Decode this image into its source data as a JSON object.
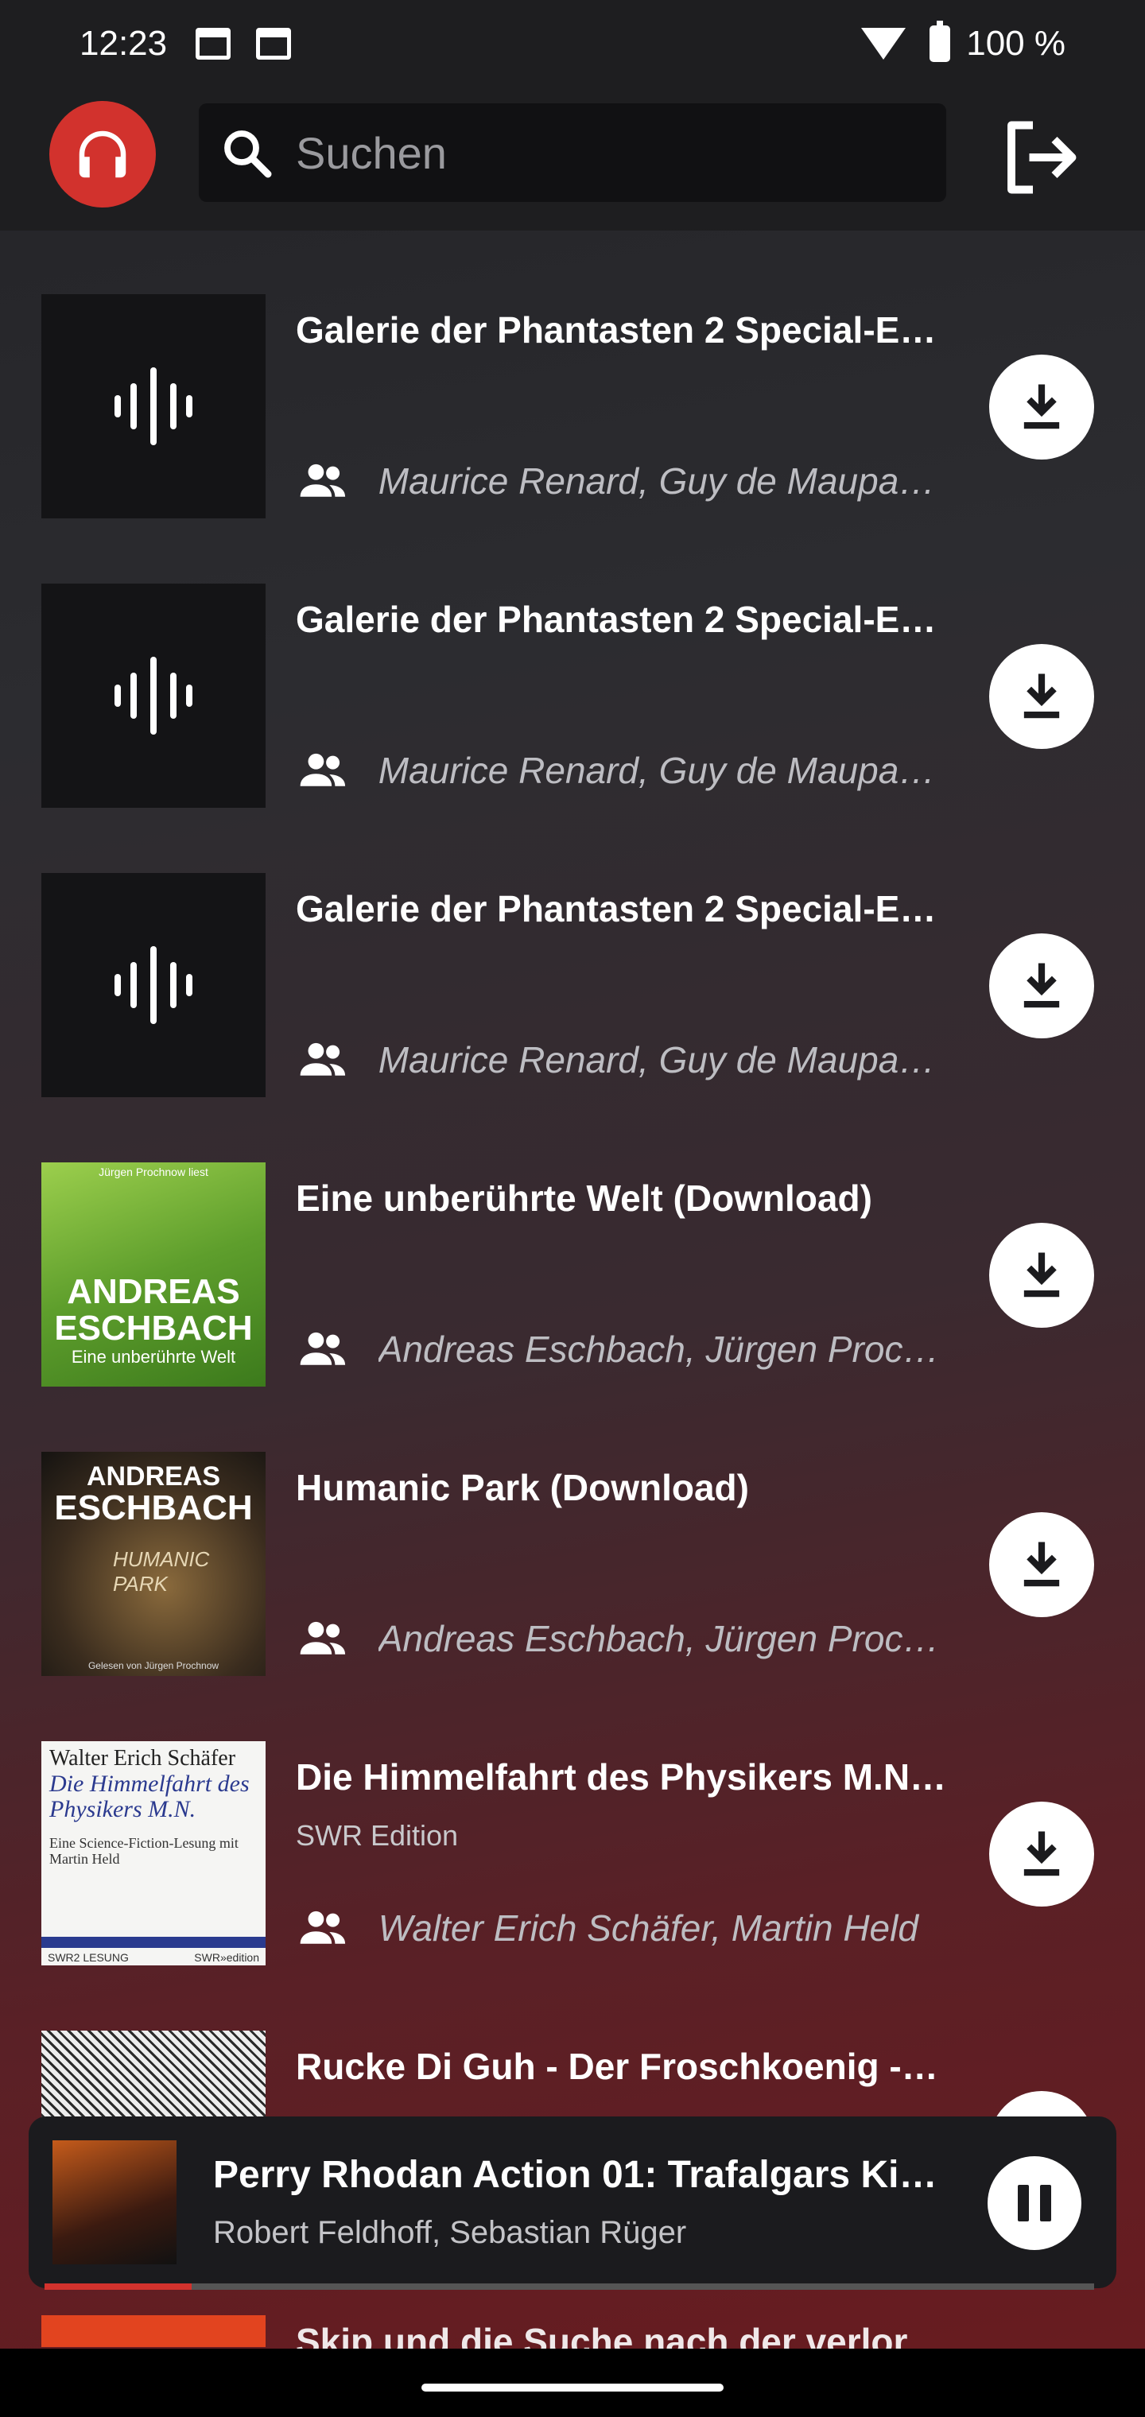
{
  "status_bar": {
    "time": "12:23",
    "battery": "100 %",
    "icons": [
      "calendar-icon",
      "calendar-icon",
      "wifi-icon",
      "battery-charging-icon"
    ]
  },
  "app_bar": {
    "logo_icon": "headphones-icon",
    "search_placeholder": "Suchen",
    "logout_icon": "logout-icon"
  },
  "items": [
    {
      "title": "Galerie der Phantasten 2 Special-E…",
      "subtitle": "",
      "authors": "Maurice Renard, Guy de Maupas…",
      "cover": "audio-wave-icon"
    },
    {
      "title": "Galerie der Phantasten 2 Special-E…",
      "subtitle": "",
      "authors": "Maurice Renard, Guy de Maupas…",
      "cover": "audio-wave-icon"
    },
    {
      "title": "Galerie der Phantasten 2 Special-E…",
      "subtitle": "",
      "authors": "Maurice Renard, Guy de Maupas…",
      "cover": "audio-wave-icon"
    },
    {
      "title": "Eine unberührte Welt (Download)",
      "subtitle": "",
      "authors": "Andreas Eschbach, Jürgen Proc…",
      "cover_text": {
        "top": "Jürgen Prochnow liest",
        "author1": "ANDREAS",
        "author2": "ESCHBACH",
        "book": "Eine unberührte Welt"
      }
    },
    {
      "title": "Humanic Park (Download)",
      "subtitle": "",
      "authors": "Andreas Eschbach, Jürgen Proc…",
      "cover_text": {
        "author1": "ANDREAS",
        "author2": "ESCHBACH",
        "book": "HUMANIC PARK",
        "reader": "Gelesen von Jürgen Prochnow"
      }
    },
    {
      "title": "Die Himmelfahrt des Physikers M.N…",
      "subtitle": "SWR Edition",
      "authors": "Walter Erich Schäfer, Martin Held",
      "cover_text": {
        "author": "Walter Erich Schäfer",
        "book": "Die Himmelfahrt des Physikers M.N.",
        "desc": "Eine Science-Fiction-Lesung mit Martin Held",
        "left": "SWR2 LESUNG",
        "right": "SWR»edition"
      }
    },
    {
      "title": "Rucke Di Guh - Der Froschkoenig - …",
      "subtitle": "",
      "authors": ""
    }
  ],
  "next_peek_title": "Skip und die Suche nach der verlor…",
  "player": {
    "title": "Perry Rhodan Action 01: Trafalgars Ki…",
    "authors": "Robert Feldhoff, Sebastian Rüger",
    "progress": 0.14,
    "pause_icon": "pause-icon"
  },
  "colors": {
    "accent": "#d2322d",
    "bar_bg": "#1e1e20",
    "text_secondary": "#bdbdc2"
  }
}
